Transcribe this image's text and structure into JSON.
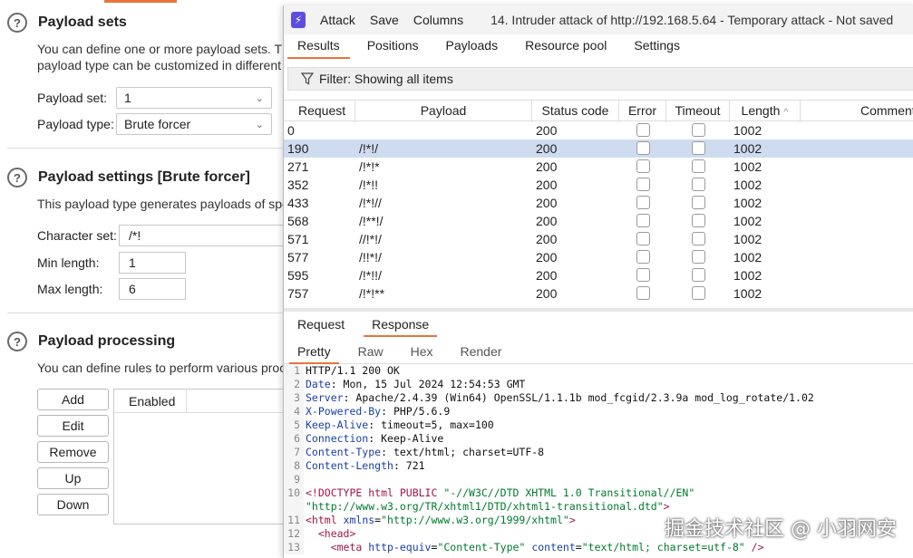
{
  "left": {
    "payload_sets": {
      "title": "Payload sets",
      "desc1": "You can define one or more payload sets. Th",
      "desc2": "payload type can be customized in different",
      "set_label": "Payload set:",
      "set_value": "1",
      "type_label": "Payload type:",
      "type_value": "Brute forcer"
    },
    "payload_settings": {
      "title": "Payload settings [Brute forcer]",
      "desc": "This payload type generates payloads of spe",
      "charset_label": "Character set:",
      "charset_value": "/*!",
      "min_label": "Min length:",
      "min_value": "1",
      "max_label": "Max length:",
      "max_value": "6"
    },
    "payload_processing": {
      "title": "Payload processing",
      "desc": "You can define rules to perform various proc",
      "buttons": [
        "Add",
        "Edit",
        "Remove",
        "Up",
        "Down"
      ],
      "column_header": "Enabled"
    },
    "help_glyph": "?"
  },
  "window": {
    "logo": "⚡",
    "menu": [
      "Attack",
      "Save",
      "Columns"
    ],
    "title": "14. Intruder attack of http://192.168.5.64 - Temporary attack - Not saved",
    "tabs": [
      "Results",
      "Positions",
      "Payloads",
      "Resource pool",
      "Settings"
    ],
    "active_tab": "Results",
    "filter_text": "Filter: Showing all items",
    "columns": [
      "Request",
      "Payload",
      "Status code",
      "Error",
      "Timeout",
      "Length",
      "Comment"
    ],
    "rows": [
      {
        "request": "0",
        "payload": "",
        "status": "200",
        "length": "1002",
        "selected": false
      },
      {
        "request": "190",
        "payload": "/!*!/",
        "status": "200",
        "length": "1002",
        "selected": true
      },
      {
        "request": "271",
        "payload": "/!*!*",
        "status": "200",
        "length": "1002",
        "selected": false
      },
      {
        "request": "352",
        "payload": "/!*!!",
        "status": "200",
        "length": "1002",
        "selected": false
      },
      {
        "request": "433",
        "payload": "/!*!//",
        "status": "200",
        "length": "1002",
        "selected": false
      },
      {
        "request": "568",
        "payload": "/!**!/",
        "status": "200",
        "length": "1002",
        "selected": false
      },
      {
        "request": "571",
        "payload": "//!*!/",
        "status": "200",
        "length": "1002",
        "selected": false
      },
      {
        "request": "577",
        "payload": "/!!*!/",
        "status": "200",
        "length": "1002",
        "selected": false
      },
      {
        "request": "595",
        "payload": "/!*!!/",
        "status": "200",
        "length": "1002",
        "selected": false
      },
      {
        "request": "757",
        "payload": "/!*!**",
        "status": "200",
        "length": "1002",
        "selected": false
      }
    ],
    "sort_indicator": "^",
    "response_tabs": [
      "Request",
      "Response"
    ],
    "active_response_tab": "Response",
    "view_tabs": [
      "Pretty",
      "Raw",
      "Hex",
      "Render"
    ],
    "active_view_tab": "Pretty",
    "code_lines": [
      {
        "n": "1",
        "parts": [
          [
            "",
            "HTTP/1.1 200 OK"
          ]
        ]
      },
      {
        "n": "2",
        "parts": [
          [
            "k",
            "Date"
          ],
          [
            "",
            ": Mon, 15 Jul 2024 12:54:53 GMT"
          ]
        ]
      },
      {
        "n": "3",
        "parts": [
          [
            "k",
            "Server"
          ],
          [
            "",
            ": Apache/2.4.39 (Win64) OpenSSL/1.1.1b mod_fcgid/2.3.9a mod_log_rotate/1.02"
          ]
        ]
      },
      {
        "n": "4",
        "parts": [
          [
            "k",
            "X-Powered-By"
          ],
          [
            "",
            ": PHP/5.6.9"
          ]
        ]
      },
      {
        "n": "5",
        "parts": [
          [
            "k",
            "Keep-Alive"
          ],
          [
            "",
            ": timeout=5, max=100"
          ]
        ]
      },
      {
        "n": "6",
        "parts": [
          [
            "k",
            "Connection"
          ],
          [
            "",
            ": Keep-Alive"
          ]
        ]
      },
      {
        "n": "7",
        "parts": [
          [
            "k",
            "Content-Type"
          ],
          [
            "",
            ": text/html; charset=UTF-8"
          ]
        ]
      },
      {
        "n": "8",
        "parts": [
          [
            "k",
            "Content-Length"
          ],
          [
            "",
            ": 721"
          ]
        ]
      },
      {
        "n": "9",
        "parts": [
          [
            "",
            ""
          ]
        ]
      },
      {
        "n": "10",
        "parts": [
          [
            "tag",
            "<!DOCTYPE html PUBLIC "
          ],
          [
            "str",
            "\"-//W3C//DTD XHTML 1.0 Transitional//EN\""
          ]
        ]
      },
      {
        "n": "",
        "parts": [
          [
            "str",
            "\"http://www.w3.org/TR/xhtml1/DTD/xhtml1-transitional.dtd\""
          ],
          [
            "tag",
            ">"
          ]
        ]
      },
      {
        "n": "11",
        "parts": [
          [
            "tag",
            "<html "
          ],
          [
            "attr",
            "xmlns"
          ],
          [
            "",
            "="
          ],
          [
            "str",
            "\"http://www.w3.org/1999/xhtml\""
          ],
          [
            "tag",
            ">"
          ]
        ]
      },
      {
        "n": "12",
        "parts": [
          [
            "",
            "  "
          ],
          [
            "tag",
            "<head>"
          ]
        ]
      },
      {
        "n": "13",
        "parts": [
          [
            "",
            "    "
          ],
          [
            "tag",
            "<meta "
          ],
          [
            "attr",
            "http-equiv"
          ],
          [
            "",
            "="
          ],
          [
            "str",
            "\"Content-Type\""
          ],
          [
            "",
            " "
          ],
          [
            "attr",
            "content"
          ],
          [
            "",
            "="
          ],
          [
            "str",
            "\"text/html; charset=utf-8\""
          ],
          [
            "",
            " "
          ],
          [
            "tag",
            "/>"
          ]
        ]
      }
    ]
  },
  "watermark": "掘金技术社区 @ 小羽网安",
  "colors": {
    "accent": "#e8743b",
    "selected_row": "#cfdcf0",
    "logo": "#5b4de0"
  }
}
